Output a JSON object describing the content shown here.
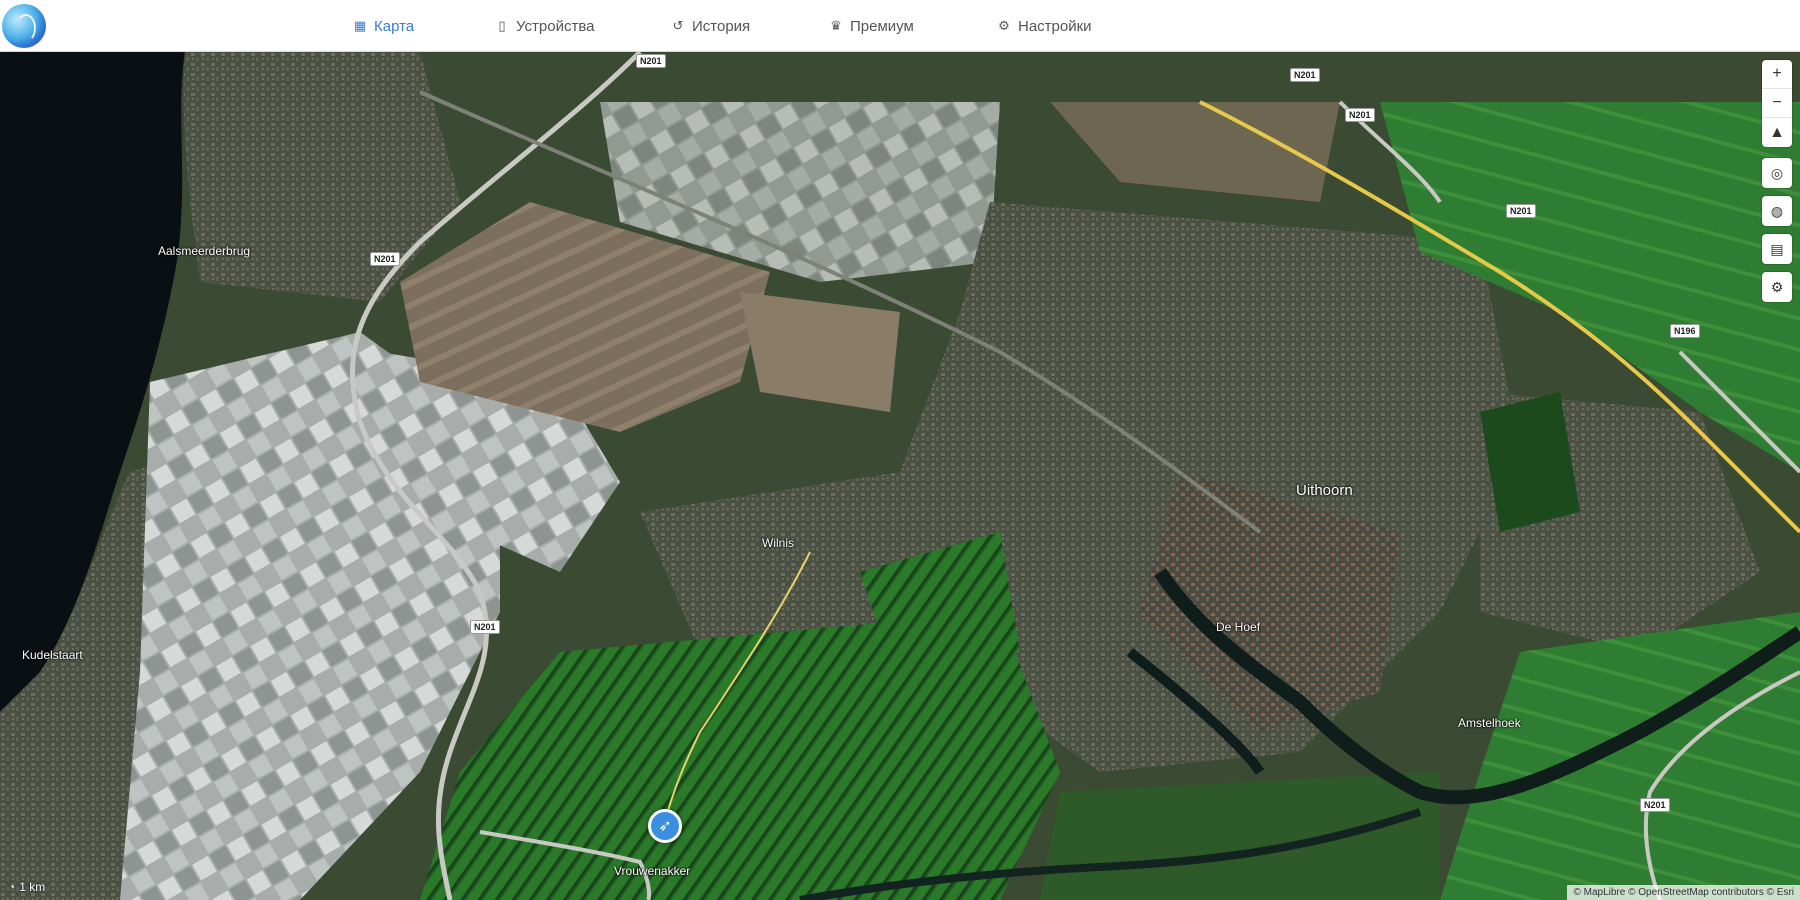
{
  "nav": {
    "items": [
      {
        "label": "Карта",
        "icon": "map-icon"
      },
      {
        "label": "Устройства",
        "icon": "phone-icon"
      },
      {
        "label": "История",
        "icon": "history-icon"
      },
      {
        "label": "Премиум",
        "icon": "crown-icon"
      },
      {
        "label": "Настройки",
        "icon": "gears-icon"
      }
    ]
  },
  "map": {
    "places": {
      "uithoorn": "Uithoorn",
      "aalsmeer": "Aalsmeerderbrug",
      "kudelstaart": "Kudelstaart",
      "aardam": "Amstelhoek",
      "mijdrecht": "Wilnis",
      "hoef": "De Hoef",
      "aarlanderveen": "Vrouwenakker"
    },
    "road_shields": [
      "N201",
      "N201",
      "N201",
      "N201",
      "N201",
      "N196",
      "N201",
      "N201"
    ],
    "controls": {
      "zoom_in": "+",
      "zoom_out": "−",
      "north": "▲"
    },
    "attribution": "© MapLibre © OpenStreetMap contributors © Esri",
    "scale_label": "1 km"
  },
  "colors": {
    "accent": "#3a7bd5",
    "marker": "#3b8fe0",
    "road_yellow": "#e6c84a"
  }
}
